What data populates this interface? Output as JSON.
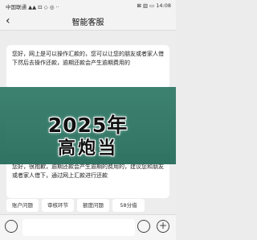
{
  "status_bar": {
    "carrier": "中国联通 ▲▲ ⊡ ◇ ◎ ··",
    "right_indicators": "⊠ ▥ ▭ 14:08"
  },
  "nav": {
    "title": "智能客服",
    "back_icon": "‹"
  },
  "messages": [
    {
      "text": "您好，网上是可以操作汇款的，您可以让您的朋友或者家人借下然后去操作还款，逾期还款会产生逾期费用的"
    },
    {
      "text": ""
    },
    {
      "text": "您好，很抱歉，逾期还款会产生逾期的费用的，建议您和朋友或者家人借下，通过网上汇款进行还款"
    }
  ],
  "banner": {
    "line1": "2025年",
    "line2": "高炮当"
  },
  "quick_replies": [
    "账户问题",
    "审核环节",
    "额度问题",
    "58分借"
  ],
  "input": {
    "placeholder": ""
  }
}
